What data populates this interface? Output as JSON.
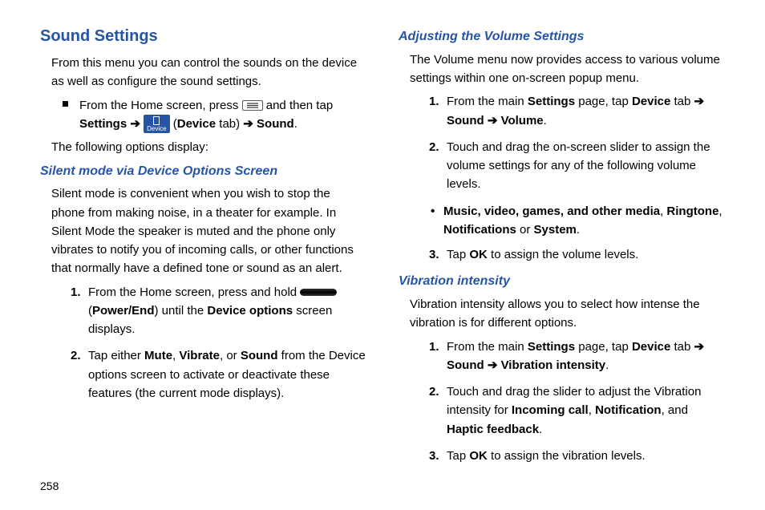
{
  "pageNumber": "258",
  "left": {
    "h1": "Sound Settings",
    "intro": "From this menu you can control the sounds on the device as well as configure the sound settings.",
    "bullet": {
      "pre": "From the Home screen, press ",
      "mid1": " and then tap ",
      "settings": "Settings",
      "arrow1": " ➔ ",
      "deviceTab_open": " (",
      "deviceTab_b": "Device",
      "deviceTab_close": " tab) ",
      "arrow2": "➔ ",
      "sound": "Sound",
      "end": "."
    },
    "afterBullet": "The following options display:",
    "h2": "Silent mode via Device Options Screen",
    "silentPara": "Silent mode is convenient when you wish to stop the phone from making noise, in a theater for example. In Silent Mode the speaker is muted and the phone only vibrates to notify you of incoming calls, or other functions that normally have a defined tone or sound as an alert.",
    "step1_num": "1.",
    "step1_pre": "From the Home screen, press and hold ",
    "step1_open": " (",
    "step1_power": "Power/End",
    "step1_mid": ") until the ",
    "step1_devopt": "Device options",
    "step1_end": " screen displays.",
    "step2_num": "2.",
    "step2_pre": "Tap either ",
    "step2_mute": "Mute",
    "step2_c1": ", ",
    "step2_vib": "Vibrate",
    "step2_c2": ", or ",
    "step2_sound": "Sound",
    "step2_end": " from the Device options screen to activate or deactivate these features (the current mode displays)."
  },
  "right": {
    "h2a": "Adjusting the Volume Settings",
    "volIntro": "The Volume menu now provides access to various volume settings within one on-screen popup menu.",
    "vol1_num": "1.",
    "vol1_pre": "From the main ",
    "vol1_settings": "Settings",
    "vol1_mid1": " page, tap ",
    "vol1_device": "Device",
    "vol1_mid2": " tab ",
    "vol1_arrow1": "➔ ",
    "vol1_sound": "Sound",
    "vol1_arrow2": " ➔ ",
    "vol1_volume": "Volume",
    "vol1_end": ".",
    "vol2_num": "2.",
    "vol2_text": "Touch and drag the on-screen slider to assign the volume settings for any of the following volume levels.",
    "vol_sub_b1": "Music, video, games, and other media",
    "vol_sub_c1": ", ",
    "vol_sub_b2": "Ringtone",
    "vol_sub_c2": ", ",
    "vol_sub_b3": "Notifications",
    "vol_sub_or": " or ",
    "vol_sub_b4": "System",
    "vol_sub_end": ".",
    "vol3_num": "3.",
    "vol3_pre": "Tap ",
    "vol3_ok": "OK",
    "vol3_end": " to assign the volume levels.",
    "h2b": "Vibration intensity",
    "vibIntro": "Vibration intensity allows you to select how intense the vibration is for different options.",
    "vib1_num": "1.",
    "vib1_pre": "From the main ",
    "vib1_settings": "Settings",
    "vib1_mid1": " page, tap ",
    "vib1_device": "Device",
    "vib1_mid2": " tab ",
    "vib1_arrow1": "➔ ",
    "vib1_sound": "Sound",
    "vib1_arrow2": " ➔ ",
    "vib1_vi": "Vibration intensity",
    "vib1_end": ".",
    "vib2_num": "2.",
    "vib2_pre": "Touch and drag the slider to adjust the Vibration intensity for ",
    "vib2_b1": "Incoming call",
    "vib2_c1": ", ",
    "vib2_b2": "Notification",
    "vib2_c2": ", and ",
    "vib2_b3": "Haptic feedback",
    "vib2_end": ".",
    "vib3_num": "3.",
    "vib3_pre": "Tap ",
    "vib3_ok": "OK",
    "vib3_end": " to assign the vibration levels."
  }
}
